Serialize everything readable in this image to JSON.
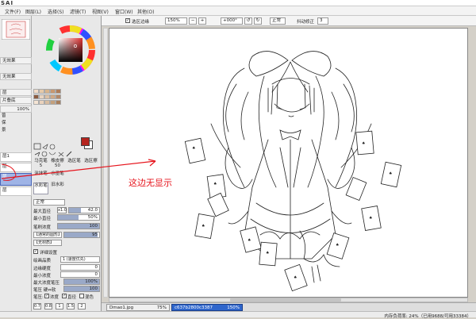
{
  "app": {
    "title": "SAI"
  },
  "menu": {
    "items": [
      "文件(F)",
      "图层(L)",
      "选择(S)",
      "滤镜(T)",
      "视图(V)",
      "窗口(W)",
      "其他(O)"
    ]
  },
  "toolbar": {
    "selection_source_label": "选区边缘",
    "zoom": "150%",
    "rotation": "+000°",
    "mode": "正常",
    "stabilizer_label": "抖动修正",
    "stabilizer_value": "3"
  },
  "left_strip": {
    "items": [
      "无效果",
      "无效果",
      "层",
      "片叠底",
      "100%",
      "曾",
      "保",
      "景",
      "层1",
      "层",
      "层"
    ],
    "highlight_label": "层"
  },
  "tools": {
    "brushes": [
      "马克笔",
      "橡皮擦",
      "选区笔",
      "选区擦",
      "涂抹笔",
      "水墨笔",
      "水彩笔",
      "旧水彩"
    ],
    "brush_values": [
      "5",
      "50",
      "",
      "",
      "",
      "",
      "",
      ""
    ],
    "mode": "正常",
    "max_size_label": "最大直径",
    "max_size_prefix": "x1.0",
    "max_size_value": "42.0",
    "min_size_label": "最小直径",
    "min_size_value": "50%",
    "density_label": "笔刷浓度",
    "density_value": "100",
    "shape_label": "【通常的圆形】",
    "shape_value": "95",
    "texture_label": "【无材质】",
    "detail_label": "详细设置",
    "quality_label": "绘画品质",
    "quality_value": "1 (速度优先)",
    "edge_label": "边缘硬度",
    "edge_value": "0",
    "min_density_label": "最小浓度",
    "min_density_value": "0",
    "max_pressure_label": "最大浓度笔压",
    "max_pressure_value": "100%",
    "pressure_label": "笔压 硬⇔软",
    "pressure_value": "100",
    "pressure_check_label": "笔压:",
    "check_density": "浓度",
    "check_diameter": "直径",
    "check_blend": "混色",
    "sizes_row1": [
      "0.7",
      "0.8",
      "1",
      "1.5",
      "2"
    ],
    "sizes_row2": [
      "2.3",
      "2.6",
      "3",
      "3.5",
      "4"
    ]
  },
  "colors": {
    "primary": "#b5241e",
    "secondary": "#ffffff",
    "wheel_center": "#d2524c",
    "palette": [
      "#f2dcc8",
      "#e6c9a8",
      "#d8b48c",
      "#c89870",
      "#b07c58",
      "#8c5c40",
      "#e8d4c0",
      "#dcc0a4",
      "#d0a884",
      "#b48868",
      "#f4e4d4",
      "#ead2bc",
      "#d8bca0",
      "#c4a07c",
      "#a87e5c"
    ]
  },
  "document_tabs": [
    {
      "name": "Dmao1.jpg",
      "zoom": "75%",
      "active": false
    },
    {
      "name": "c637b2800c3387",
      "zoom": "150%",
      "active": true
    }
  ],
  "statusbar": {
    "text": "内存负荷率: 24%（已用9688/可用33384）"
  },
  "annotation": {
    "text": "这边无显示"
  }
}
